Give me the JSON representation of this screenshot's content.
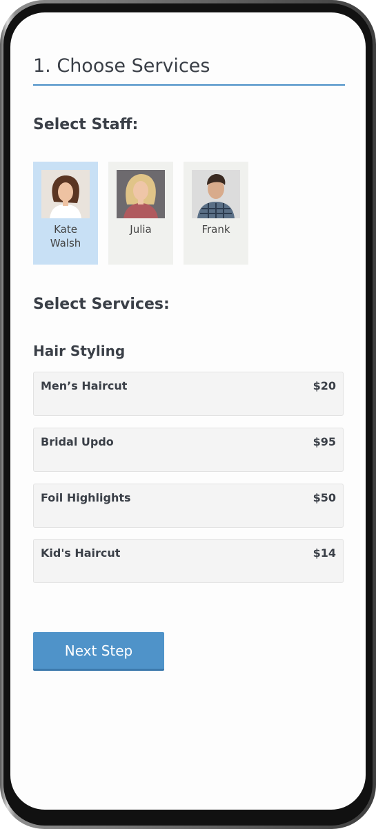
{
  "header": {
    "title": "1. Choose Services"
  },
  "staff": {
    "heading": "Select Staff:",
    "members": [
      {
        "name": "Kate\nWalsh",
        "selected": true,
        "avatar_icon": "woman-brunette-avatar"
      },
      {
        "name": "Julia",
        "selected": false,
        "avatar_icon": "woman-blonde-avatar"
      },
      {
        "name": "Frank",
        "selected": false,
        "avatar_icon": "man-plaid-shirt-avatar"
      }
    ]
  },
  "services": {
    "heading": "Select Services:",
    "category": "Hair Styling",
    "items": [
      {
        "name": "Men’s Haircut",
        "price": "$20"
      },
      {
        "name": "Bridal Updo",
        "price": "$95"
      },
      {
        "name": "Foil Highlights",
        "price": "$50"
      },
      {
        "name": "Kid's Haircut",
        "price": "$14"
      }
    ]
  },
  "actions": {
    "next_label": "Next Step"
  },
  "colors": {
    "accent": "#4f93c9",
    "selected_staff": "#c8e0f5",
    "rule": "#4a8fc7"
  }
}
